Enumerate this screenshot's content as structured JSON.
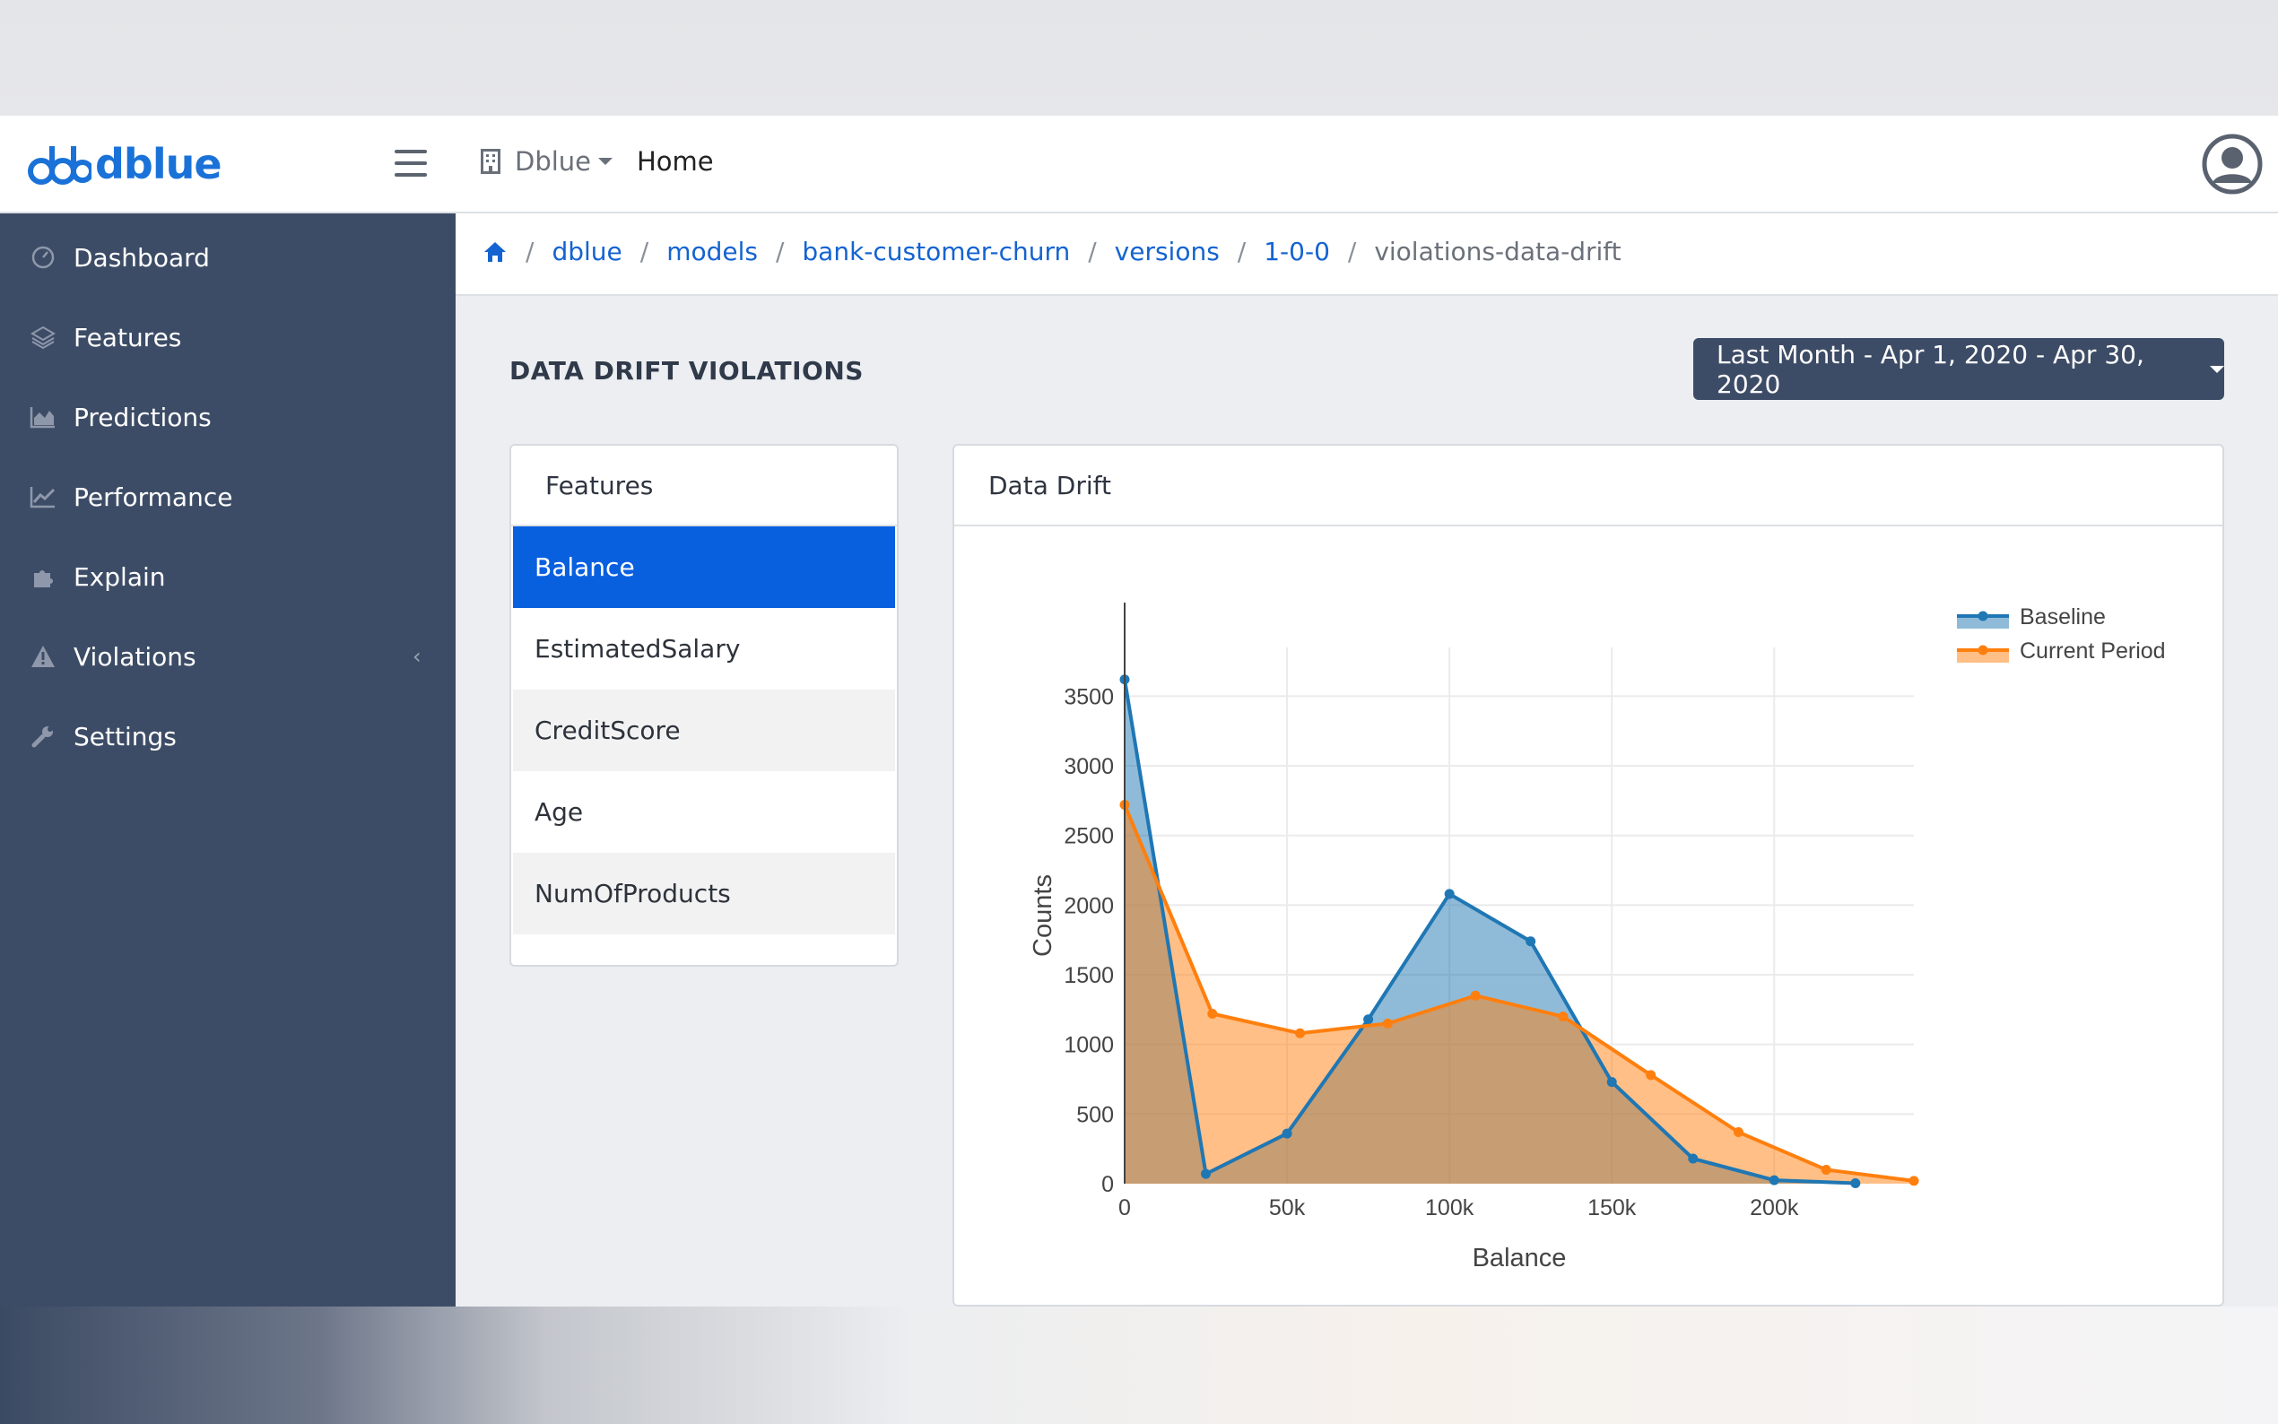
{
  "brand": {
    "name": "dblue"
  },
  "topbar": {
    "org_label": "Dblue",
    "home_label": "Home"
  },
  "sidebar": {
    "items": [
      {
        "label": "Dashboard",
        "icon": "dashboard-icon"
      },
      {
        "label": "Features",
        "icon": "layers-icon"
      },
      {
        "label": "Predictions",
        "icon": "area-chart-icon"
      },
      {
        "label": "Performance",
        "icon": "line-chart-icon"
      },
      {
        "label": "Explain",
        "icon": "puzzle-icon"
      },
      {
        "label": "Violations",
        "icon": "warning-icon"
      },
      {
        "label": "Settings",
        "icon": "wrench-icon"
      }
    ]
  },
  "breadcrumb": {
    "items": [
      "dblue",
      "models",
      "bank-customer-churn",
      "versions",
      "1-0-0"
    ],
    "current": "violations-data-drift"
  },
  "page": {
    "title": "DATA DRIFT VIOLATIONS",
    "date_range": "Last Month - Apr 1, 2020 - Apr 30, 2020"
  },
  "features_panel": {
    "title": "Features",
    "items": [
      "Balance",
      "EstimatedSalary",
      "CreditScore",
      "Age",
      "NumOfProducts"
    ],
    "selected": "Balance"
  },
  "drift_panel": {
    "title": "Data Drift"
  },
  "colors": {
    "sidebar": "#3d4c66",
    "accent": "#0960df",
    "link": "#1463d1",
    "baseline": "#1f77b4",
    "current": "#ff7f0e"
  },
  "chart_data": {
    "type": "area",
    "xlabel": "Balance",
    "ylabel": "Counts",
    "xlim": [
      0,
      243000
    ],
    "ylim": [
      0,
      3850
    ],
    "x_ticks": [
      0,
      50000,
      100000,
      150000,
      200000
    ],
    "x_tick_labels": [
      "0",
      "50k",
      "100k",
      "150k",
      "200k"
    ],
    "y_ticks": [
      0,
      500,
      1000,
      1500,
      2000,
      2500,
      3000,
      3500
    ],
    "y_tick_labels": [
      "0",
      "500",
      "1000",
      "1500",
      "2000",
      "2500",
      "3000",
      "3500"
    ],
    "grid": true,
    "legend_position": "top-right",
    "series": [
      {
        "name": "Baseline",
        "color": "#1f77b4",
        "x": [
          0,
          25000,
          50000,
          75000,
          100000,
          125000,
          150000,
          175000,
          200000,
          225000
        ],
        "y": [
          3620,
          70,
          360,
          1180,
          2080,
          1740,
          730,
          180,
          25,
          3
        ]
      },
      {
        "name": "Current Period",
        "color": "#ff7f0e",
        "x": [
          0,
          27000,
          54000,
          81000,
          108000,
          135000,
          162000,
          189000,
          216000,
          243000
        ],
        "y": [
          2720,
          1220,
          1080,
          1150,
          1350,
          1200,
          780,
          370,
          100,
          20
        ]
      }
    ]
  }
}
